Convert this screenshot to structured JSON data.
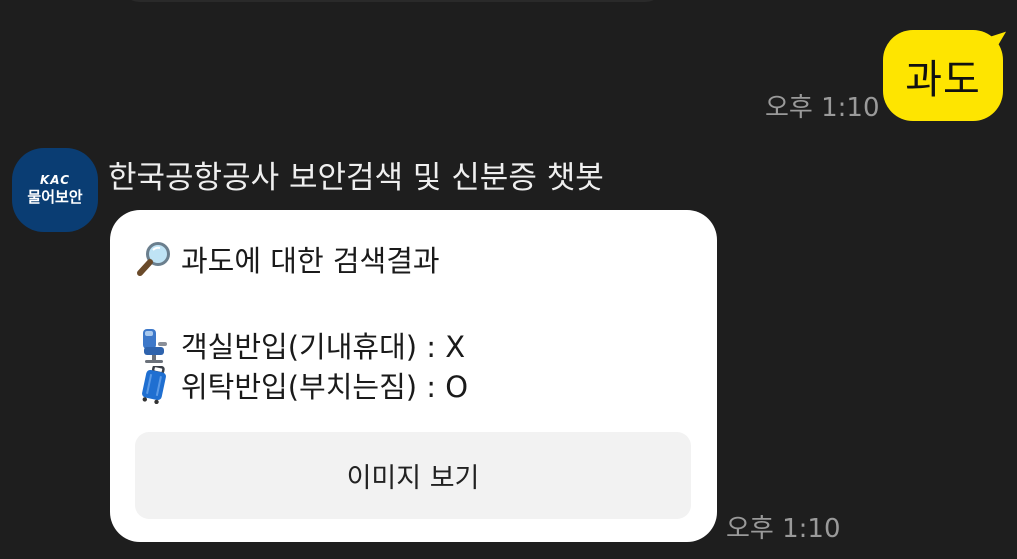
{
  "messages": {
    "outgoing": {
      "text": "과도",
      "time": "오후 1:10"
    },
    "incoming": {
      "sender_name": "한국공항공사 보안검색 및 신분증 챗봇",
      "avatar": {
        "brand": "KAC",
        "label": "물어보안",
        "color": "#0a3d73"
      },
      "lines": {
        "result_title": "과도에 대한 검색결과",
        "cabin": "객실반입(기내휴대) : X",
        "checked": "위탁반입(부치는짐) : O"
      },
      "icons": {
        "result_title": "magnifier-icon",
        "cabin": "seat-icon",
        "checked": "suitcase-icon"
      },
      "button_label": "이미지 보기",
      "time": "오후 1:10"
    }
  },
  "colors": {
    "background": "#1e1e1e",
    "outgoing_bubble": "#fee500",
    "incoming_card": "#ffffff",
    "button_bg": "#f2f2f2",
    "timestamp": "#9a9a9a"
  }
}
